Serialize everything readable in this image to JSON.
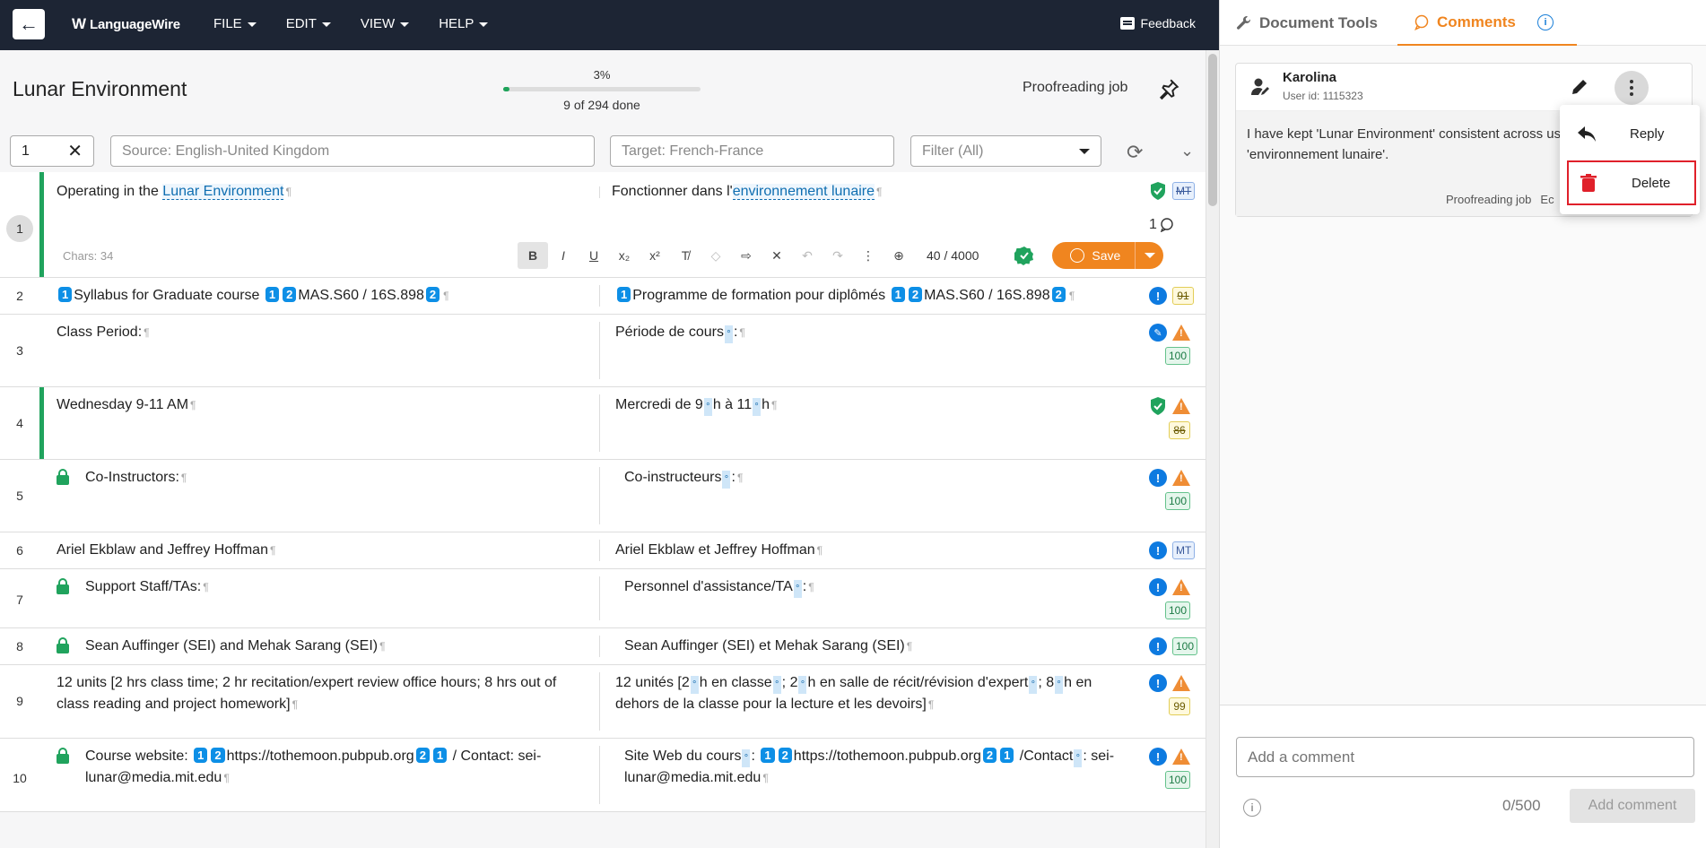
{
  "nav": {
    "back_label": "←",
    "logo": "LanguageWire",
    "menu": [
      "FILE",
      "EDIT",
      "VIEW",
      "HELP"
    ],
    "feedback": "Feedback"
  },
  "header": {
    "doc_title": "Lunar Environment",
    "progress_pct": "3%",
    "progress_value": 3,
    "progress_done": "9 of 294 done",
    "job_type": "Proofreading job"
  },
  "filters": {
    "segment_value": "1",
    "source_placeholder": "Source: English-United Kingdom",
    "target_placeholder": "Target: French-France",
    "filter_label": "Filter (All)"
  },
  "row1": {
    "num": "1",
    "chars": "Chars: 34",
    "counter": "40 / 4000",
    "save": "Save",
    "comments_count": "1",
    "badge": "MT",
    "src_pre": "Operating in the ",
    "src_term": "Lunar Environment",
    "tgt_pre": "Fonctionner dans l'",
    "tgt_term": "environnement lunaire"
  },
  "toolbar": {
    "bold": "B",
    "italic": "I",
    "underline": "U",
    "subscript": "x₂",
    "superscript": "x²"
  },
  "rows": [
    {
      "num": "2",
      "badge": "91"
    },
    {
      "num": "3",
      "src": "Class Period:",
      "tgt_pre": "Période de cours",
      "tgt_post": ":",
      "badge": "100"
    },
    {
      "num": "4",
      "src": "Wednesday 9-11 AM",
      "badge": "86"
    },
    {
      "num": "5",
      "src": "Co-Instructors:",
      "tgt_pre": "Co-instructeurs",
      "tgt_post": ":",
      "badge": "100"
    },
    {
      "num": "6",
      "src": "Ariel Ekblaw and Jeffrey Hoffman",
      "tgt": "Ariel Ekblaw et Jeffrey Hoffman",
      "badge": "MT"
    },
    {
      "num": "7",
      "src": "Support Staff/TAs:",
      "tgt_pre": "Personnel d'assistance/TA",
      "tgt_post": ":",
      "badge": "100"
    },
    {
      "num": "8",
      "src": "Sean Auffinger (SEI) and Mehak Sarang (SEI)",
      "tgt": "Sean Auffinger (SEI) et Mehak Sarang (SEI)",
      "badge": "100"
    },
    {
      "num": "9",
      "src": "12 units [2 hrs class time; 2 hr recitation/expert review office hours; 8 hrs out of class reading and project homework]",
      "badge": "99"
    },
    {
      "num": "10",
      "badge": "100"
    }
  ],
  "row2": {
    "src_a": "Syllabus for Graduate course ",
    "src_b": "MAS.S60 / 16S.898",
    "tgt_a": "Programme de formation pour diplômés ",
    "tgt_b": "MAS.S60 / 16S.898"
  },
  "row4": {
    "tgt_a": "Mercredi de 9",
    "tgt_b": "h à 11",
    "tgt_c": "h"
  },
  "row9": {
    "tgt_a": "12 unités [2",
    "tgt_b": "h en classe",
    "tgt_c": "; 2",
    "tgt_d": "h en salle de récit/révision d'expert",
    "tgt_e": "; 8",
    "tgt_f": "h en dehors de la classe pour la lecture et les devoirs]"
  },
  "row10": {
    "src_a": "Course website: ",
    "src_b": "https://tothemoon.pubpub.org",
    "src_c": " / Contact: sei-lunar@media.mit.edu",
    "tgt_a": "Site Web du cours",
    "tgt_b": ": ",
    "tgt_c": "https://tothemoon.pubpub.org",
    "tgt_d": " /Contact",
    "tgt_e": ": sei-lunar@media.mit.edu"
  },
  "panel": {
    "tab_tools": "Document Tools",
    "tab_comments": "Comments",
    "comment": {
      "author": "Karolina",
      "user_id": "User id: 1115323",
      "text": "I have kept 'Lunar Environment' consistent across used preferred term: 'environnement lunaire'.",
      "footer_job": "Proofreading job",
      "footer_extra": "Ec"
    },
    "context_menu": {
      "reply": "Reply",
      "delete": "Delete"
    },
    "composer": {
      "placeholder": "Add a comment",
      "char_limit": "0/500",
      "add_button": "Add comment"
    }
  },
  "colors": {
    "nav_bg": "#1d2534",
    "accent": "#f0851f",
    "green": "#20a35d",
    "tag_blue": "#0d8fe6",
    "delete_red": "#e0202a"
  }
}
